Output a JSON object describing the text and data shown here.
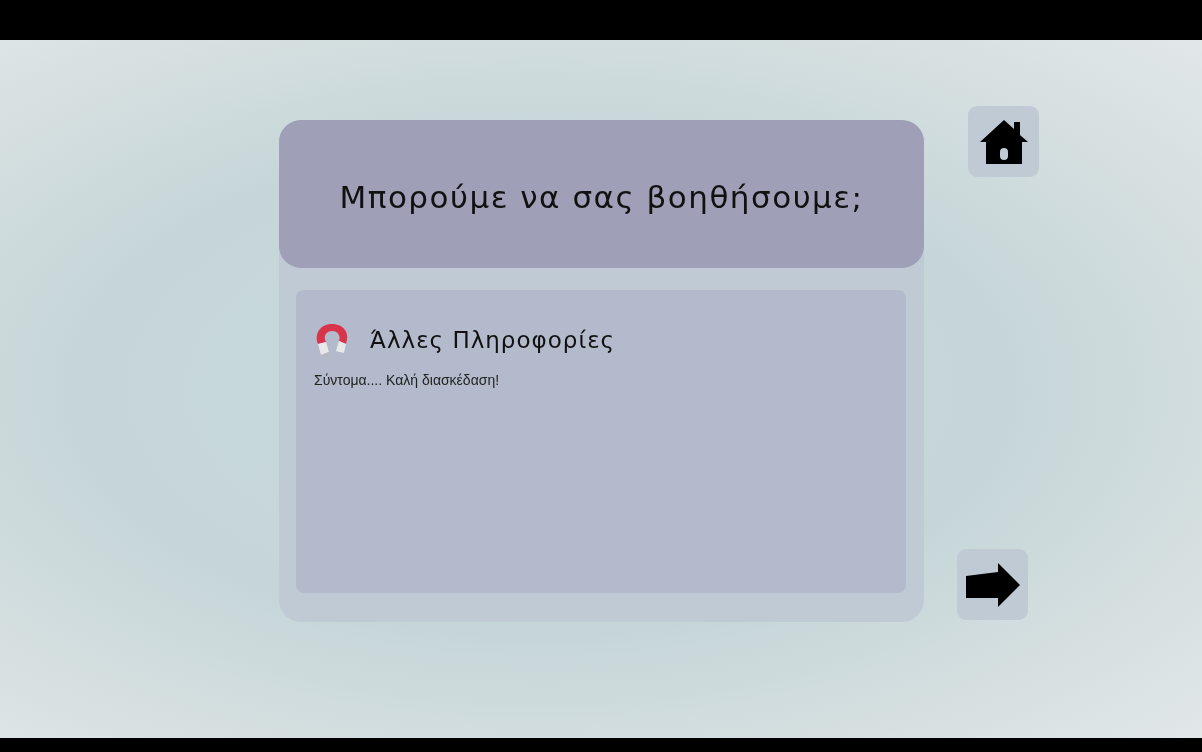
{
  "dialog": {
    "title": "Μπορούμε να σας βοηθήσουμε;",
    "section": {
      "heading": "Άλλες Πληροφορίες",
      "text": "Σύντομα.... Καλή διασκέδαση!"
    }
  }
}
